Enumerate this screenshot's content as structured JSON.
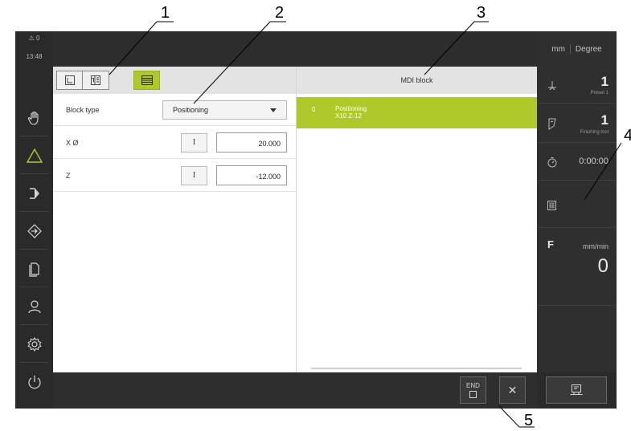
{
  "callouts": [
    "1",
    "2",
    "3",
    "4",
    "5"
  ],
  "sidebar": {
    "warnings": "⚠ 0",
    "time": "13:48",
    "items": [
      {
        "name": "manual-operation",
        "icon": "hand-icon"
      },
      {
        "name": "mdi-mode",
        "icon": "triangle-icon"
      },
      {
        "name": "program-run",
        "icon": "arrow-right-bracket-icon"
      },
      {
        "name": "setup",
        "icon": "setup-diamond-icon"
      },
      {
        "name": "file-management",
        "icon": "files-icon"
      },
      {
        "name": "user-login",
        "icon": "user-icon"
      },
      {
        "name": "settings",
        "icon": "gear-icon"
      },
      {
        "name": "power",
        "icon": "power-icon"
      }
    ]
  },
  "status": {
    "unit_length": "mm",
    "unit_angle": "Degree",
    "preset_value": "1",
    "preset_label": "Preset 1",
    "tool_value": "1",
    "tool_label": "Finishing tool",
    "timer": "0:00:00",
    "feed_label": "F",
    "feed_unit": "mm/min",
    "feed_value": "0"
  },
  "block_form": {
    "tabs": [
      "axis-view-icon",
      "split-view-icon",
      "form-view-icon"
    ],
    "block_type_label": "Block type",
    "block_type_value": "Positioning",
    "rows": [
      {
        "label": "X Ø",
        "ibutton": "I",
        "value": "20.000"
      },
      {
        "label": "Z",
        "ibutton": "I",
        "value": "-12.000"
      }
    ]
  },
  "mdi": {
    "header": "MDI block",
    "blocks": [
      {
        "index": "0",
        "line1": "Positioning",
        "line2": "X10 Z-12"
      }
    ]
  },
  "bottom": {
    "end_label": "END",
    "close_symbol": "✕"
  },
  "colors": {
    "accent": "#afc92a",
    "dark": "#2d2d2d"
  }
}
